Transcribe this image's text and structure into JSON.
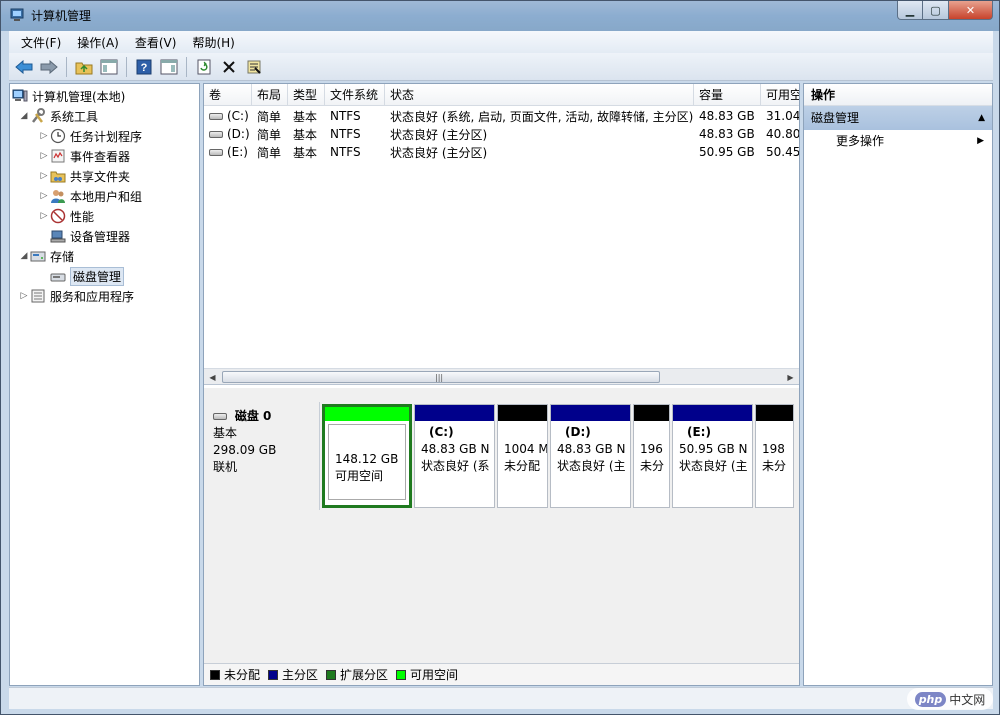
{
  "window": {
    "title": "计算机管理"
  },
  "menubar": {
    "items": [
      "文件(F)",
      "操作(A)",
      "查看(V)",
      "帮助(H)"
    ]
  },
  "tree": {
    "root": "计算机管理(本地)",
    "system_tools": "系统工具",
    "task_scheduler": "任务计划程序",
    "event_viewer": "事件查看器",
    "shared_folders": "共享文件夹",
    "local_users": "本地用户和组",
    "performance": "性能",
    "device_manager": "设备管理器",
    "storage": "存储",
    "disk_management": "磁盘管理",
    "services_apps": "服务和应用程序"
  },
  "volumes": {
    "headers": [
      "卷",
      "布局",
      "类型",
      "文件系统",
      "状态",
      "容量",
      "可用空"
    ],
    "rows": [
      [
        "(C:)",
        "简单",
        "基本",
        "NTFS",
        "状态良好 (系统, 启动, 页面文件, 活动, 故障转储, 主分区)",
        "48.83 GB",
        "31.04"
      ],
      [
        "(D:)",
        "简单",
        "基本",
        "NTFS",
        "状态良好 (主分区)",
        "48.83 GB",
        "40.80"
      ],
      [
        "(E:)",
        "简单",
        "基本",
        "NTFS",
        "状态良好 (主分区)",
        "50.95 GB",
        "50.45"
      ]
    ]
  },
  "disk": {
    "name": "磁盘 0",
    "type": "基本",
    "size": "298.09 GB",
    "status": "联机",
    "partitions": [
      {
        "name": "",
        "size": "148.12 GB",
        "status": "可用空间",
        "color": "#00ff00",
        "kind": "free"
      },
      {
        "name": "(C:)",
        "size": "48.83 GB N",
        "status": "状态良好 (系",
        "color": "#00008b",
        "kind": "primary"
      },
      {
        "name": "",
        "size": "1004 M",
        "status": "未分配",
        "color": "#000000",
        "kind": "unalloc"
      },
      {
        "name": "(D:)",
        "size": "48.83 GB N",
        "status": "状态良好 (主",
        "color": "#00008b",
        "kind": "primary"
      },
      {
        "name": "",
        "size": "196",
        "status": "未分",
        "color": "#000000",
        "kind": "unalloc"
      },
      {
        "name": "(E:)",
        "size": "50.95 GB N",
        "status": "状态良好 (主",
        "color": "#00008b",
        "kind": "primary"
      },
      {
        "name": "",
        "size": "198",
        "status": "未分",
        "color": "#000000",
        "kind": "unalloc"
      }
    ]
  },
  "legend": [
    {
      "label": "未分配",
      "color": "#000000"
    },
    {
      "label": "主分区",
      "color": "#00008b"
    },
    {
      "label": "扩展分区",
      "color": "#1f7a1f"
    },
    {
      "label": "可用空间",
      "color": "#00ff00"
    }
  ],
  "actions": {
    "header": "操作",
    "section": "磁盘管理",
    "more": "更多操作"
  },
  "watermark": {
    "logo": "php",
    "text": "中文网"
  }
}
